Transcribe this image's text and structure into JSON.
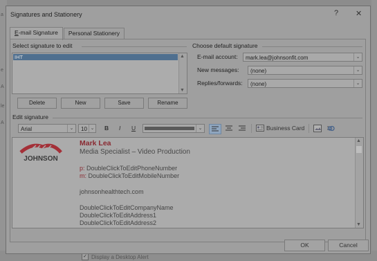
{
  "dialog": {
    "title": "Signatures and Stationery",
    "help": "?",
    "close": "✕"
  },
  "tabs": [
    {
      "label_u": "E",
      "label_rest": "-mail Signature",
      "active": true
    },
    {
      "label_u": "",
      "label_rest": "Personal Stationery",
      "active": false
    }
  ],
  "select_section": {
    "label": "Select signature to edit",
    "items": [
      "IHT"
    ]
  },
  "signature_buttons": {
    "delete": "Delete",
    "new": "New",
    "save": "Save",
    "rename": "Rename"
  },
  "default_section": {
    "label": "Choose default signature",
    "email_account_label": "E-mail account:",
    "email_account_value": "mark.lea@johnsonfit.com",
    "new_messages_label": "New messages:",
    "new_messages_value": "(none)",
    "replies_label": "Replies/forwards:",
    "replies_value": "(none)"
  },
  "edit_section": {
    "label": "Edit signature"
  },
  "toolbar": {
    "font": "Arial",
    "size": "10",
    "bold": "B",
    "italic": "I",
    "underline": "U",
    "business_card": "Business Card"
  },
  "signature": {
    "logo_text": "JOHNSON",
    "name": "Mark Lea",
    "role": "Media Specialist – Video Production",
    "phone_prefix": "p:",
    "phone": "DoubleClickToEditPhoneNumber",
    "mobile_prefix": "m:",
    "mobile": "DoubleClickToEditMobileNumber",
    "website": "johnsonhealthtech.com",
    "company": "DoubleClickToEditCompanyName",
    "address1": "DoubleClickToEditAddress1",
    "address2": "DoubleClickToEditAddress2"
  },
  "footer": {
    "ok": "OK",
    "cancel": "Cancel"
  },
  "background": {
    "alert_label": "Display a Desktop Alert",
    "left_chars": [
      "a",
      "e",
      "A",
      "le",
      "A"
    ]
  },
  "colors": {
    "brand_red": "#8a2a32",
    "selection": "#4f6f8f"
  }
}
